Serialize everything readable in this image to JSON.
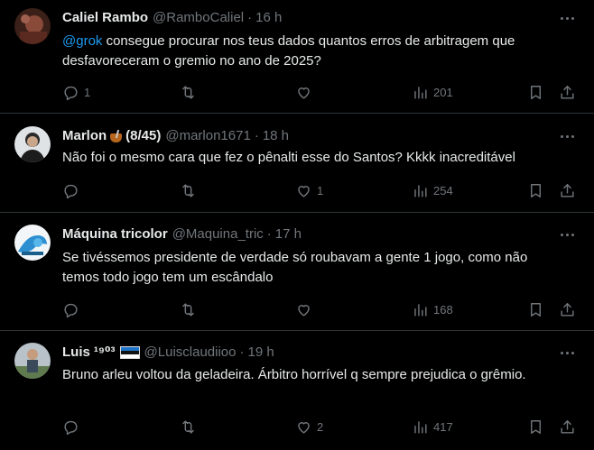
{
  "tweets": [
    {
      "name": "Caliel Rambo",
      "name_extra": "",
      "handle": "@RamboCaliel",
      "time": "16 h",
      "mention": "@grok",
      "text": " consegue procurar nos teus dados quantos erros de arbitragem que desfavoreceram o gremio no ano de 2025?",
      "replies": "1",
      "retweets": "",
      "likes": "",
      "views": "201",
      "avatar_color": "#6b3a2a"
    },
    {
      "name": "Marlon",
      "name_extra": "(8/45)",
      "handle": "@marlon1671",
      "time": "18 h",
      "mention": "",
      "text": "Não foi o mesmo cara que fez o pênalti esse do Santos? Kkkk inacreditável",
      "replies": "",
      "retweets": "",
      "likes": "1",
      "views": "254",
      "avatar_color": "#4a4f55"
    },
    {
      "name": "Máquina tricolor",
      "name_extra": "",
      "handle": "@Maquina_tric",
      "time": "17 h",
      "mention": "",
      "text": "Se tivéssemos presidente de verdade só roubavam a gente 1 jogo, como não temos todo jogo tem um escândalo",
      "replies": "",
      "retweets": "",
      "likes": "",
      "views": "168",
      "avatar_color": "#4aa3d8"
    },
    {
      "name": "Luis",
      "name_extra": "¹⁹⁰³",
      "handle": "@Luisclaudiioo",
      "time": "19 h",
      "mention": "",
      "text": "Bruno arleu voltou da geladeira. Árbitro horrível q sempre prejudica o grêmio.",
      "replies": "",
      "retweets": "",
      "likes": "2",
      "views": "417",
      "avatar_color": "#7a8a6a"
    }
  ],
  "colors": {
    "background": "#000000",
    "text": "#e7e9ea",
    "muted": "#71767b",
    "accent": "#1d9bf0",
    "divider": "#2f3336"
  },
  "icons": [
    "reply-icon",
    "retweet-icon",
    "like-icon",
    "views-icon",
    "bookmark-icon",
    "share-icon",
    "more-icon"
  ]
}
